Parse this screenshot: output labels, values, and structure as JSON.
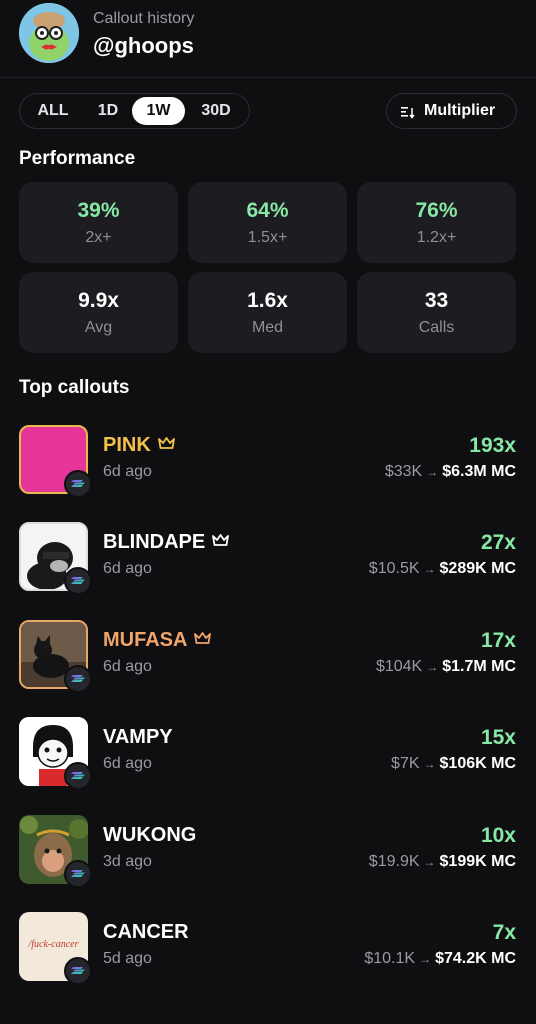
{
  "header": {
    "subtitle": "Callout history",
    "username": "@ghoops"
  },
  "filters": {
    "periods": [
      "ALL",
      "1D",
      "1W",
      "30D"
    ],
    "selected": "1W",
    "sort_label": "Multiplier",
    "sort_icon": "sort-icon"
  },
  "performance": {
    "title": "Performance",
    "stats": [
      {
        "value": "39%",
        "label": "2x+"
      },
      {
        "value": "64%",
        "label": "1.5x+"
      },
      {
        "value": "76%",
        "label": "1.2x+"
      },
      {
        "value": "9.9x",
        "label": "Avg"
      },
      {
        "value": "1.6x",
        "label": "Med"
      },
      {
        "value": "33",
        "label": "Calls"
      }
    ]
  },
  "top_callouts": {
    "title": "Top callouts",
    "items": [
      {
        "name": "PINK",
        "ago": "6d ago",
        "multiplier": "193x",
        "from_mc": "$33K",
        "to_mc": "$6.3M MC",
        "name_color": "#f2c24c",
        "crown": true,
        "thumb": "pink-token-thumbnail",
        "chain_icon": "solana-icon"
      },
      {
        "name": "BLINDAPE",
        "ago": "6d ago",
        "multiplier": "27x",
        "from_mc": "$10.5K",
        "to_mc": "$289K MC",
        "name_color": "#ffffff",
        "crown": true,
        "thumb": "blindape-token-thumbnail",
        "chain_icon": "solana-icon"
      },
      {
        "name": "MUFASA",
        "ago": "6d ago",
        "multiplier": "17x",
        "from_mc": "$104K",
        "to_mc": "$1.7M MC",
        "name_color": "#f0a56a",
        "crown": true,
        "thumb": "mufasa-token-thumbnail",
        "chain_icon": "solana-icon"
      },
      {
        "name": "VAMPY",
        "ago": "6d ago",
        "multiplier": "15x",
        "from_mc": "$7K",
        "to_mc": "$106K MC",
        "name_color": "#ffffff",
        "crown": false,
        "thumb": "vampy-token-thumbnail",
        "chain_icon": "solana-icon"
      },
      {
        "name": "WUKONG",
        "ago": "3d ago",
        "multiplier": "10x",
        "from_mc": "$19.9K",
        "to_mc": "$199K MC",
        "name_color": "#ffffff",
        "crown": false,
        "thumb": "wukong-token-thumbnail",
        "chain_icon": "solana-icon"
      },
      {
        "name": "CANCER",
        "ago": "5d ago",
        "multiplier": "7x",
        "from_mc": "$10.1K",
        "to_mc": "$74.2K MC",
        "name_color": "#ffffff",
        "crown": false,
        "thumb": "cancer-token-thumbnail",
        "chain_icon": "solana-icon",
        "thumb_text": "/fuck-cancer"
      }
    ]
  },
  "colors": {
    "background": "#0f0f12",
    "card": "#1c1c21",
    "accent_green": "#86e8a4",
    "gold": "#f2c24c",
    "orange": "#f0a56a"
  }
}
